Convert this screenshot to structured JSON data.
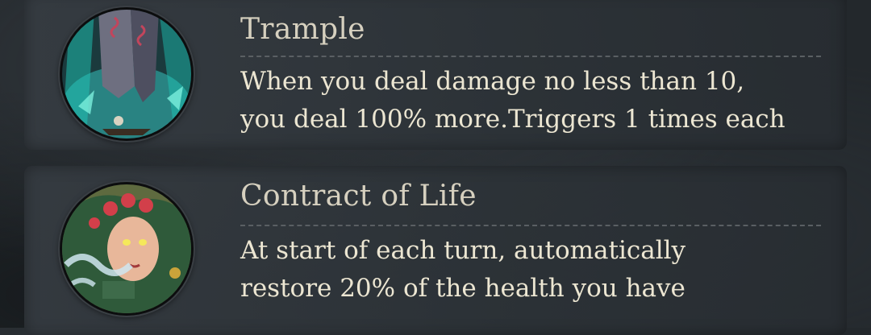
{
  "skills": [
    {
      "title": "Trample",
      "description_lines": [
        "When you deal damage no less than 10,",
        "you deal 100% more.Triggers 1 times each"
      ],
      "icon": "trample-portrait-icon"
    },
    {
      "title": "Contract of Life",
      "description_lines": [
        "At start of each turn, automatically",
        "restore 20% of the health you have"
      ],
      "icon": "contract-of-life-portrait-icon"
    }
  ],
  "colors": {
    "background": "#23282c",
    "title": "#d6d0bf",
    "description": "#ece6d2",
    "divider": "#5a5f63"
  }
}
